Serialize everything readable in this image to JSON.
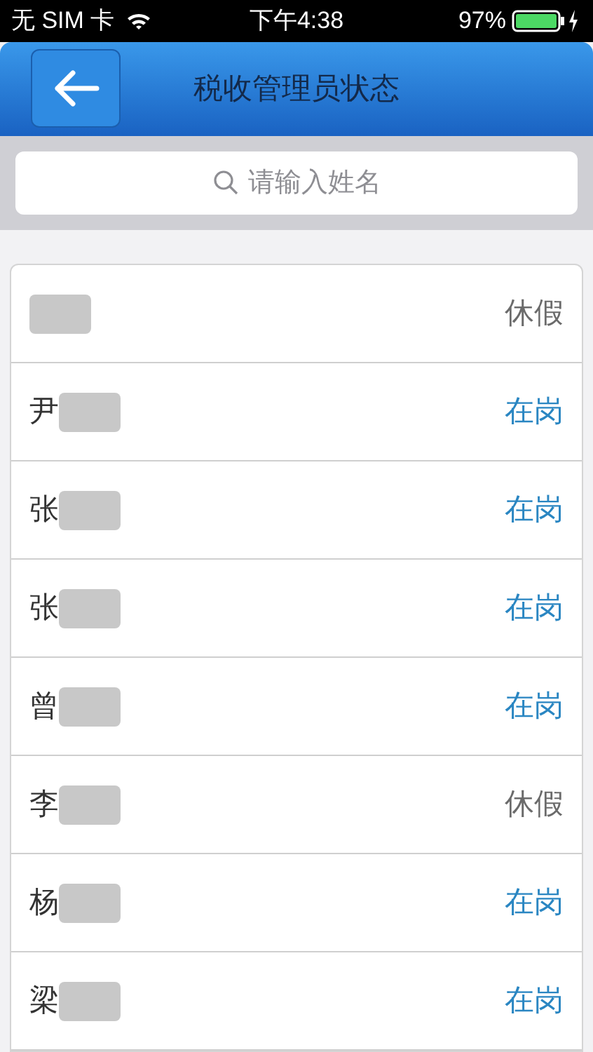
{
  "status_bar": {
    "carrier": "无 SIM 卡",
    "time": "下午4:38",
    "battery": "97%"
  },
  "header": {
    "title": "税收管理员状态"
  },
  "search": {
    "placeholder": "请输入姓名"
  },
  "rows": [
    {
      "status": "休假",
      "kind": "leave"
    },
    {
      "name": "尹",
      "status": "在岗",
      "kind": "on_duty"
    },
    {
      "name": "张",
      "status": "在岗",
      "kind": "on_duty"
    },
    {
      "name": "张",
      "status": "在岗",
      "kind": "on_duty"
    },
    {
      "name": "曾",
      "status": "在岗",
      "kind": "on_duty"
    },
    {
      "name": "李",
      "status": "休假",
      "kind": "leave"
    },
    {
      "name": "杨",
      "status": "在岗",
      "kind": "on_duty"
    },
    {
      "name": "梁",
      "status": "在岗",
      "kind": "on_duty"
    }
  ]
}
